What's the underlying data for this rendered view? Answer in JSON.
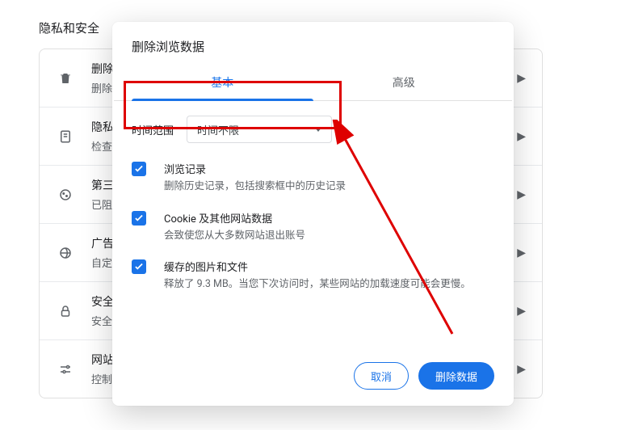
{
  "page": {
    "title": "隐私和安全"
  },
  "settings_list": {
    "items": [
      {
        "icon": "trash",
        "line1": "删除",
        "line2": "删除"
      },
      {
        "icon": "privacy-guide",
        "line1": "隐私",
        "line2": "检查"
      },
      {
        "icon": "cookie",
        "line1": "第三",
        "line2": "已阻"
      },
      {
        "icon": "ads",
        "line1": "广告",
        "line2": "自定"
      },
      {
        "icon": "lock",
        "line1": "安全",
        "line2": "安全"
      },
      {
        "icon": "sliders",
        "line1": "网站",
        "line2": "控制"
      }
    ]
  },
  "modal": {
    "title": "删除浏览数据",
    "tabs": {
      "basic": "基本",
      "advanced": "高级",
      "active": "basic"
    },
    "time": {
      "label": "时间范围",
      "selected": "时间不限"
    },
    "options": [
      {
        "title": "浏览记录",
        "desc": "删除历史记录，包括搜索框中的历史记录",
        "checked": true
      },
      {
        "title": "Cookie 及其他网站数据",
        "desc": "会致使您从大多数网站退出账号",
        "checked": true
      },
      {
        "title": "缓存的图片和文件",
        "desc": "释放了 9.3 MB。当您下次访问时，某些网站的加载速度可能会更慢。",
        "checked": true
      }
    ],
    "buttons": {
      "cancel": "取消",
      "confirm": "删除数据"
    }
  },
  "colors": {
    "accent": "#1a73e8",
    "highlight_border": "#de0000"
  }
}
